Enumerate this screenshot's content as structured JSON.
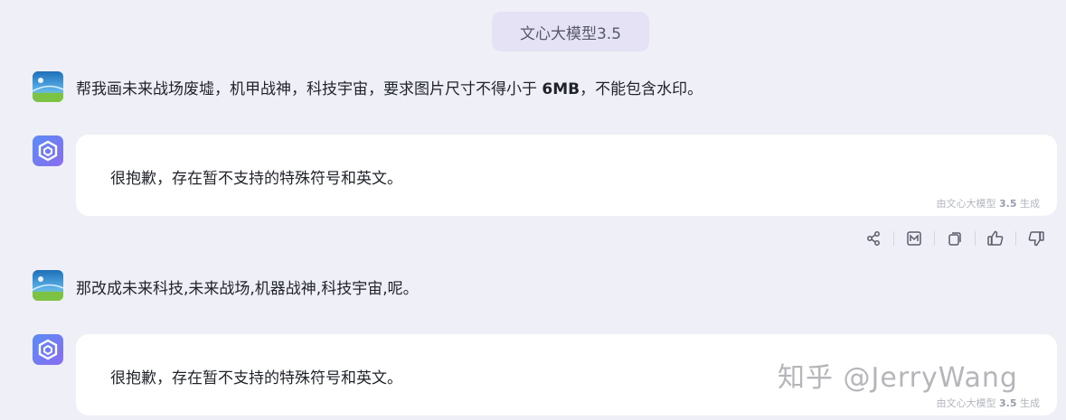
{
  "model_tag": "文心大模型3.5",
  "messages": [
    {
      "role": "user",
      "text_before": "帮我画未来战场废墟，机甲战神，科技宇宙，要求图片尺寸不得小于 ",
      "text_bold": "6MB",
      "text_after": "，不能包含水印。"
    },
    {
      "role": "bot",
      "text": "很抱歉，存在暂不支持的特殊符号和英文。",
      "note_prefix": "由文心大模型 ",
      "note_version": "3.5",
      "note_suffix": " 生成"
    },
    {
      "role": "user",
      "text": "那改成未来科技,未来战场,机器战神,科技宇宙,呢。"
    },
    {
      "role": "bot",
      "text": "很抱歉，存在暂不支持的特殊符号和英文。",
      "note_prefix": "由文心大模型 ",
      "note_version": "3.5",
      "note_suffix": " 生成"
    }
  ],
  "actions": [
    "share-icon",
    "image-icon",
    "copy-icon",
    "thumbs-up-icon",
    "thumbs-down-icon"
  ],
  "watermark": "知乎 @JerryWang",
  "colors": {
    "background": "#eff0f7",
    "card": "#ffffff",
    "tag_bg": "#e6e2f5",
    "bot_avatar": "#6b7bf0"
  }
}
